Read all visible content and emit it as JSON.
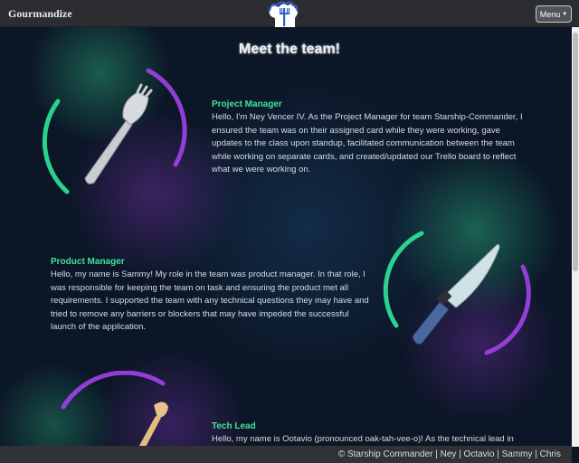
{
  "navbar": {
    "brand": "Gourmandize",
    "logo_icon": "chef-hat-cutlery-logo-icon",
    "menu_label": "Menu"
  },
  "page": {
    "heading": "Meet the team!"
  },
  "team": [
    {
      "title": "Project Manager",
      "bio": "Hello, I'm Ney Vencer IV. As the Project Manager for team Starship-Commander, I ensured the team was on their assigned card while they were working, gave updates to the class upon standup, facilitated communication between the team while working on separate cards, and created/updated our Trello board to reflect what we were working on.",
      "image_icon": "spork-icon"
    },
    {
      "title": "Product Manager",
      "bio": "Hello, my name is Sammy! My role in the team was product manager. In that role, I was responsible for keeping the team on task and ensuring the product met all requirements. I supported the team with any technical questions they may have and tried to remove any barriers or blockers that may have impeded the successful launch of the application.",
      "image_icon": "kitchen-knife-icon"
    },
    {
      "title": "Tech Lead",
      "bio": "Hello, my name is Ootavio (pronounced oak-tah-vee-o)! As the technical lead in",
      "image_icon": "wooden-spoon-icon"
    }
  ],
  "footer": {
    "text": "© Starship Commander | Ney | Octavio | Sammy | Chris"
  },
  "colors": {
    "accent_green": "#43e39b",
    "accent_purple": "#9b3fe0",
    "navbar": "#2b2d30",
    "background": "#0b1626"
  }
}
